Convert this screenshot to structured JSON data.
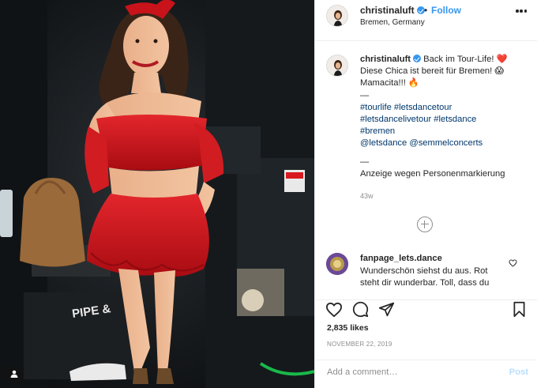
{
  "post": {
    "user": "christinaluft",
    "follow_dot": "•",
    "follow_label": "Follow",
    "location": "Bremen, Germany",
    "photo": {
      "bag_label": "PIPE &"
    },
    "caption": {
      "user": "christinaluft",
      "line1": "Back im Tour-Life! ❤️",
      "line2": "Diese Chica ist bereit für Bremen! 😱",
      "line3": "Mamacita!!! 🔥",
      "sep1": "—",
      "hashtags_line1": "#tourlife #letsdancetour",
      "hashtags_line2": "#letsdancelivetour #letsdance",
      "hashtags_line3": "#bremen",
      "mentions": "@letsdance @semmelconcerts",
      "sep2": "—",
      "disclosure": "Anzeige wegen Personenmarkierung",
      "time": "43w"
    },
    "comment": {
      "user": "fanpage_lets.dance",
      "text": "Wunderschön siehst du aus. Rot steht dir wunderbar. Toll, dass du"
    },
    "likes": "2,835 likes",
    "date": "NOVEMBER 22, 2019",
    "add_comment_placeholder": "Add a comment…",
    "post_button": "Post"
  },
  "icons": {
    "like": "heart-icon",
    "comment": "comment-icon",
    "share": "share-icon",
    "save": "bookmark-icon",
    "more": "more-options-icon",
    "verified": "verified-badge-icon",
    "load_more": "plus-circle-icon",
    "tagged_people": "tagged-user-icon",
    "comment_like": "small-heart-icon"
  },
  "colors": {
    "follow_blue": "#3897f0",
    "hashtag": "#00376b",
    "dress_red": "#d4141c",
    "post_disabled": "#b9dffc",
    "muted_text": "#8e8e8e"
  }
}
